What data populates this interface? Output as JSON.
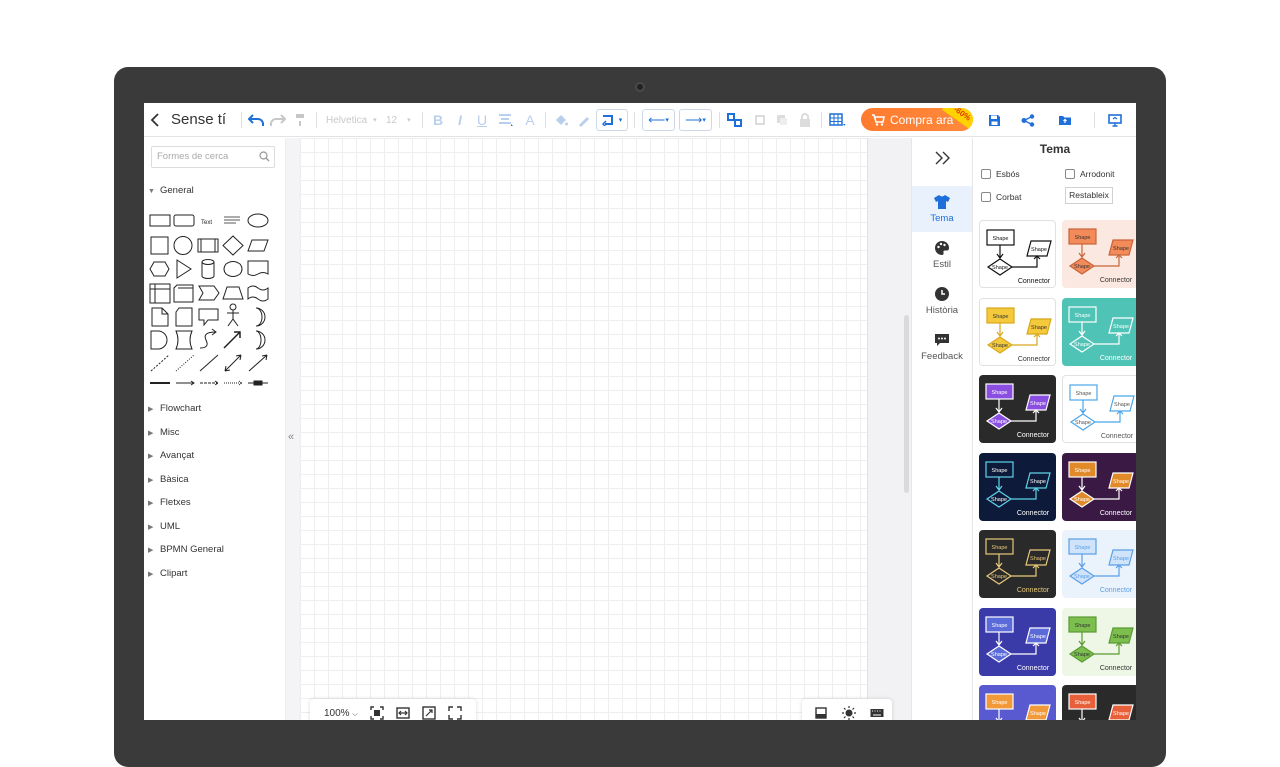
{
  "document": {
    "title": "Sense tí"
  },
  "toolbar": {
    "font_family": "Helvetica",
    "font_size": "12",
    "buy_label": "Compra ara",
    "discount_tag": "-60%"
  },
  "library": {
    "search_placeholder": "Formes de cerca",
    "open_section": "General",
    "text_shape_label": "Text",
    "sections": [
      "Flowchart",
      "Misc",
      "Avançat",
      "Bàsica",
      "Fletxes",
      "UML",
      "BPMN General",
      "Clipart"
    ]
  },
  "canvas": {
    "zoom": "100%"
  },
  "right_nav": {
    "items": [
      {
        "label": "Tema",
        "icon": "shirt-icon",
        "active": true
      },
      {
        "label": "Estil",
        "icon": "palette-icon",
        "active": false
      },
      {
        "label": "Història",
        "icon": "clock-icon",
        "active": false
      },
      {
        "label": "Feedback",
        "icon": "chat-icon",
        "active": false
      }
    ]
  },
  "theme_panel": {
    "title": "Tema",
    "options": {
      "sketch": "Esbós",
      "rounded": "Arrodonit",
      "curved": "Corbat"
    },
    "reset_label": "Restableix",
    "shape_label": "Shape",
    "connector_label": "Connector",
    "themes": [
      {
        "bg": "#ffffff",
        "fill": "#ffffff",
        "stroke": "#111111",
        "text": "#111111",
        "outline": true
      },
      {
        "bg": "#fbe9e1",
        "fill": "#f28a5a",
        "stroke": "#c8643a",
        "text": "#333333",
        "outline": false
      },
      {
        "bg": "#ffffff",
        "fill": "#f5c93c",
        "stroke": "#d8a81c",
        "text": "#333333",
        "outline": true
      },
      {
        "bg": "#4fc3b5",
        "fill": "#4fc3b5",
        "stroke": "#ffffff",
        "text": "#ffffff",
        "outline": false
      },
      {
        "bg": "#2a2a2a",
        "fill": "#8a4fe0",
        "stroke": "#ffffff",
        "text": "#ffffff",
        "outline": false
      },
      {
        "bg": "#ffffff",
        "fill": "#ffffff",
        "stroke": "#4aa6e8",
        "text": "#555555",
        "outline": true
      },
      {
        "bg": "#0e1a3a",
        "fill": "#0e1a3a",
        "stroke": "#5fd3e8",
        "text": "#ffffff",
        "outline": false
      },
      {
        "bg": "#3a1a44",
        "fill": "#e08a2a",
        "stroke": "#ffffff",
        "text": "#ffffff",
        "outline": false
      },
      {
        "bg": "#2a2a2a",
        "fill": "#2a2a2a",
        "stroke": "#e9c97a",
        "text": "#e9c97a",
        "outline": false
      },
      {
        "bg": "#eaf3fc",
        "fill": "#cfe4fa",
        "stroke": "#5b9ee6",
        "text": "#5b9ee6",
        "outline": false
      },
      {
        "bg": "#3a3aa8",
        "fill": "#5a6ad8",
        "stroke": "#ffffff",
        "text": "#ffffff",
        "outline": false
      },
      {
        "bg": "#eef7e6",
        "fill": "#7cbf4e",
        "stroke": "#5a9a34",
        "text": "#333333",
        "outline": false
      },
      {
        "bg": "#5a5ad0",
        "fill": "#f29a3a",
        "stroke": "#ffffff",
        "text": "#ffffff",
        "outline": false
      },
      {
        "bg": "#2a2a2a",
        "fill": "#e8603a",
        "stroke": "#ffffff",
        "text": "#ffffff",
        "outline": false
      }
    ]
  },
  "colors": {
    "accent": "#1e6fd9",
    "buy": "#ff7a2f",
    "device": "#3a3a3a"
  }
}
